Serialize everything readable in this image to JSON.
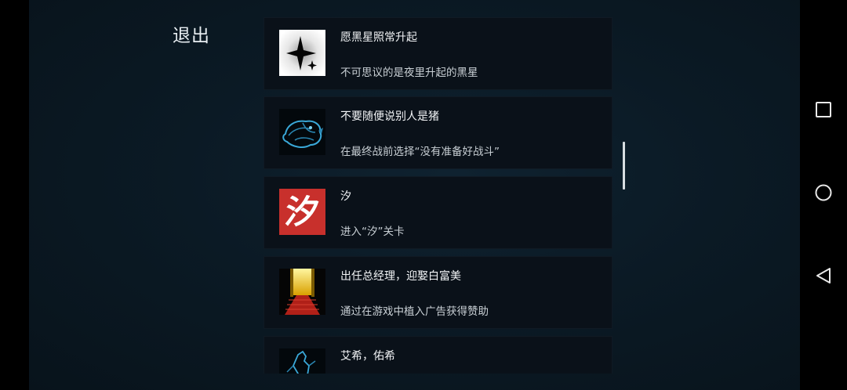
{
  "header": {
    "exit_label": "退出"
  },
  "achievements": [
    {
      "title": "愿黑星照常升起",
      "description": "不可思议的是夜里升起的黑星",
      "icon": "black-star-icon"
    },
    {
      "title": "不要随便说别人是猪",
      "description": "在最终战前选择“没有准备好战斗”",
      "icon": "blue-pig-icon"
    },
    {
      "title": "汐",
      "description": "进入“汐”关卡",
      "icon": "xi-character-icon",
      "icon_char": "汐"
    },
    {
      "title": "出任总经理，迎娶白富美",
      "description": "通过在游戏中植入广告获得赞助",
      "icon": "red-carpet-door-icon"
    },
    {
      "title": "艾希，佑希",
      "description": "",
      "icon": "blue-figure-icon"
    }
  ],
  "colors": {
    "background": "#0b1a25",
    "card": "#0a1119",
    "xi_red": "#c8302c"
  },
  "system_nav": {
    "recent": "square-icon",
    "home": "circle-icon",
    "back": "triangle-back-icon"
  }
}
